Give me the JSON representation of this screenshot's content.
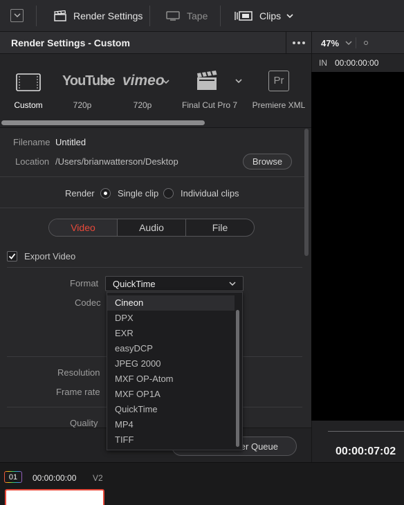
{
  "toolbar": {
    "items": [
      {
        "label": "Render Settings",
        "icon": "clapperboard-icon"
      },
      {
        "label": "Tape",
        "icon": "monitor-icon"
      },
      {
        "label": "Clips",
        "icon": "clips-icon"
      }
    ]
  },
  "panel": {
    "title": "Render Settings - Custom"
  },
  "presets": [
    {
      "label": "Custom",
      "icon": "film-strip-icon",
      "active": true
    },
    {
      "label": "720p",
      "icon": "youtube-logo"
    },
    {
      "label": "720p",
      "icon": "vimeo-logo"
    },
    {
      "label": "Final Cut Pro 7",
      "icon": "clapperboard-icon"
    },
    {
      "label": "Premiere XML",
      "icon": "premiere-icon"
    }
  ],
  "logos": {
    "youtube": "YouTube",
    "vimeo": "vimeo",
    "premiere": "Pr"
  },
  "file": {
    "filename_label": "Filename",
    "filename_value": "Untitled",
    "location_label": "Location",
    "location_value": "/Users/brianwatterson/Desktop",
    "browse_label": "Browse"
  },
  "render": {
    "label": "Render",
    "options": [
      "Single clip",
      "Individual clips"
    ],
    "selected": "Single clip"
  },
  "tabs": [
    {
      "label": "Video",
      "active": true
    },
    {
      "label": "Audio"
    },
    {
      "label": "File"
    }
  ],
  "export_video": {
    "label": "Export Video",
    "checked": true
  },
  "format": {
    "label": "Format",
    "value": "QuickTime"
  },
  "codec": {
    "label": "Codec"
  },
  "resolution": {
    "label": "Resolution"
  },
  "frame_rate": {
    "label": "Frame rate"
  },
  "quality": {
    "label": "Quality"
  },
  "format_options": [
    "Cineon",
    "DPX",
    "EXR",
    "easyDCP",
    "JPEG 2000",
    "MXF OP-Atom",
    "MXF OP1A",
    "QuickTime",
    "MP4",
    "TIFF"
  ],
  "format_highlighted": "Cineon",
  "queue_button": {
    "label": "er Queue"
  },
  "viewer": {
    "zoom": "47%",
    "in_label": "IN",
    "in_time": "00:00:00:00",
    "duration": "00:00:07:02"
  },
  "timeline": {
    "clip_number": "01",
    "timecode": "00:00:00:00",
    "track": "V2"
  },
  "colors": {
    "accent": "#e8493a",
    "background": "#1f1f21"
  }
}
